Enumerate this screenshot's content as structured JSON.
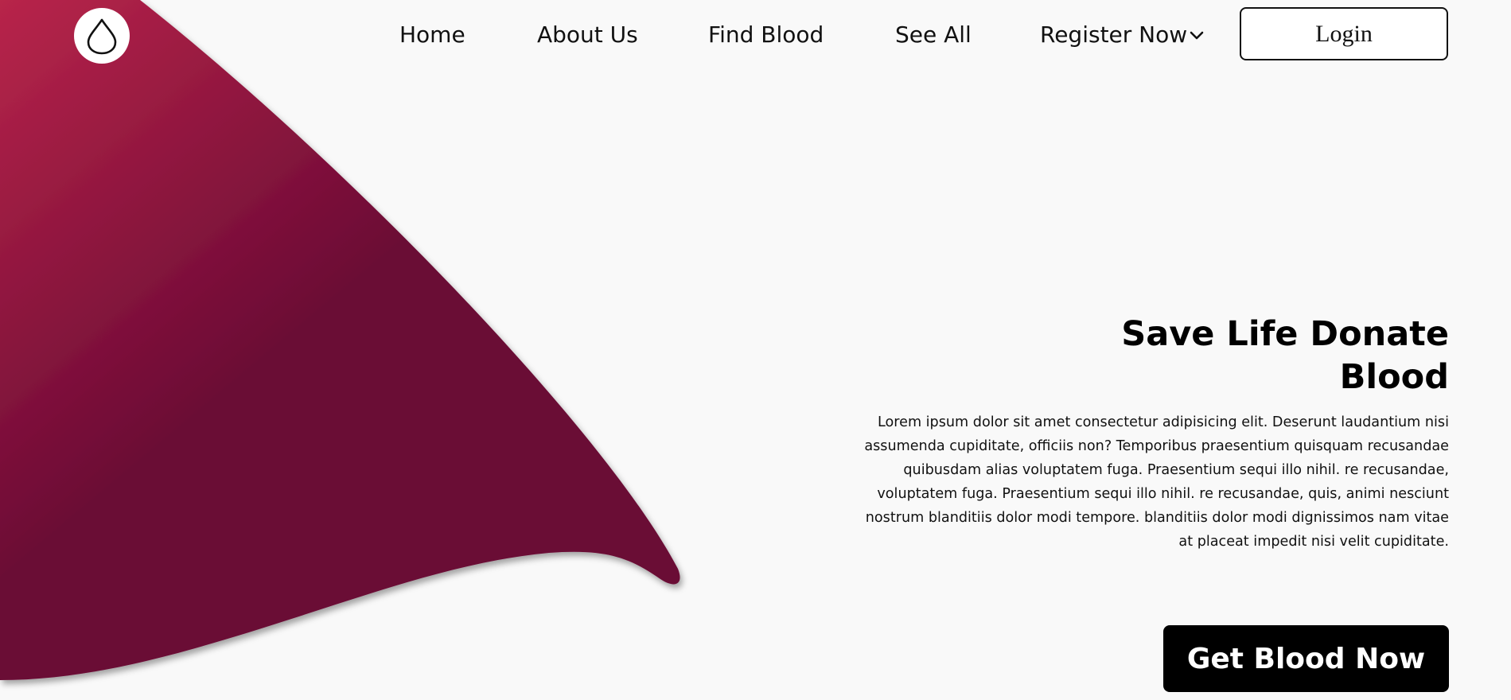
{
  "brand": {
    "logo_icon": "blood-drop-icon",
    "accent_light": "#b8254a",
    "accent_dark": "#6b0a35"
  },
  "nav": {
    "home": "Home",
    "about": "About Us",
    "find_blood": "Find Blood",
    "see_all": "See All",
    "register": "Register Now",
    "register_icon": "chevron-down-icon",
    "login": "Login"
  },
  "hero": {
    "title": "Save Life Donate Blood",
    "description": "Lorem ipsum dolor sit amet consectetur adipisicing elit. Deserunt laudantium nisi assumenda cupiditate, officiis non? Temporibus praesentium quisquam recusandae quibusdam alias voluptatem fuga. Praesentium sequi illo nihil. re recusandae, voluptatem fuga. Praesentium sequi illo nihil. re recusandae, quis, animi nesciunt nostrum blanditiis dolor modi tempore. blanditiis dolor modi dignissimos nam vitae at placeat impedit nisi velit cupiditate.",
    "cta": "Get Blood Now"
  }
}
